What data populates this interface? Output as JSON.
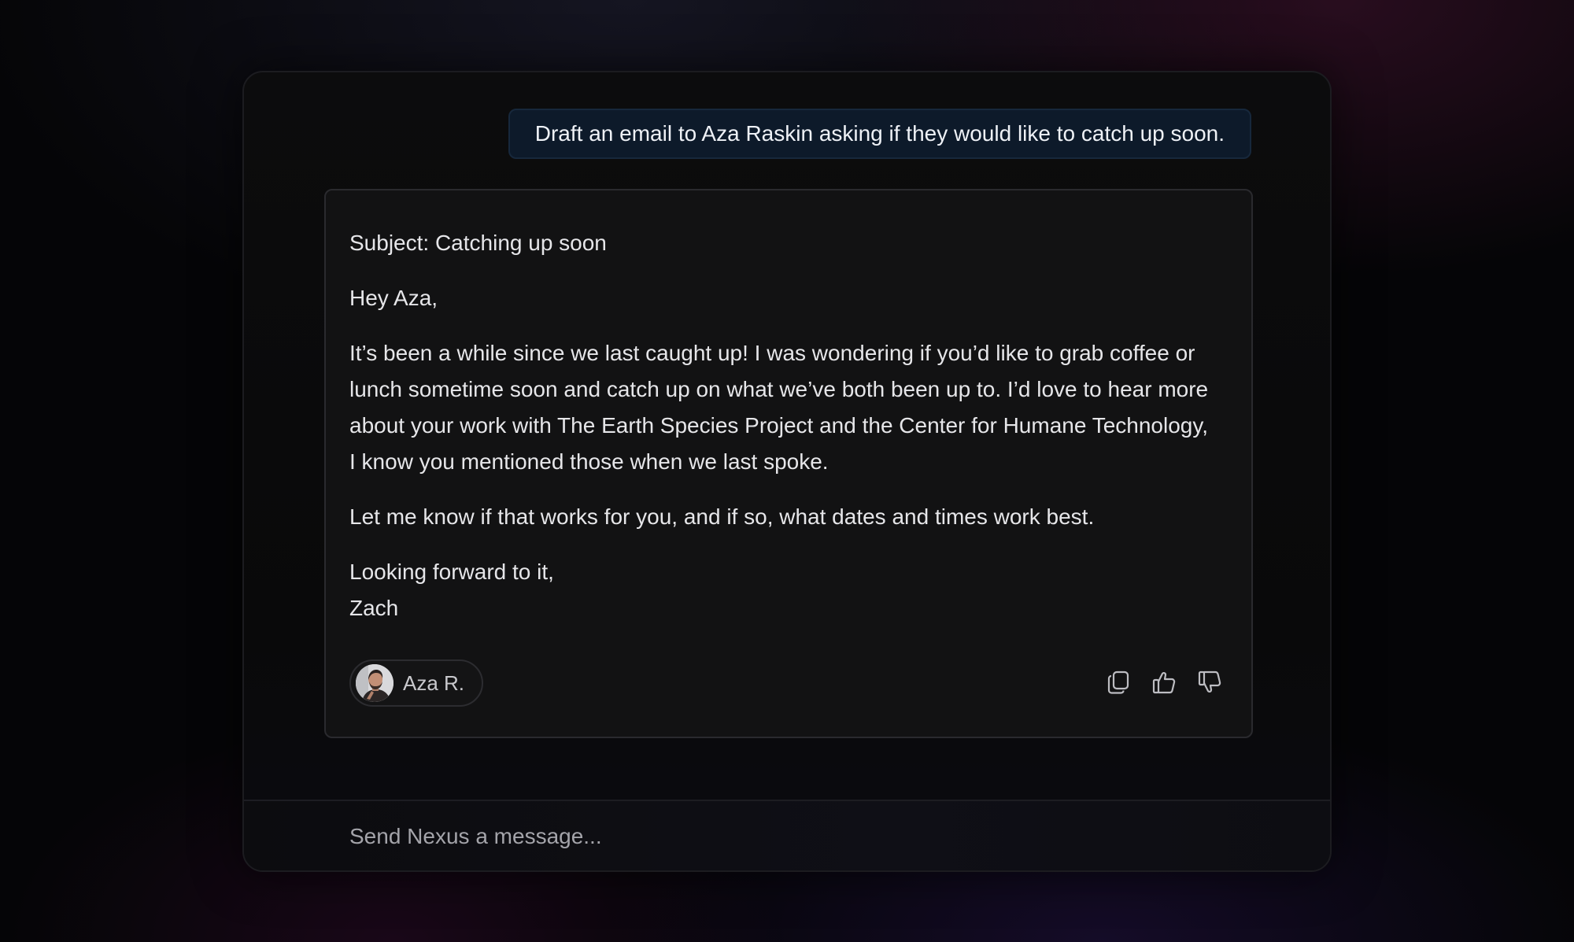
{
  "conversation": {
    "user_message": "Draft an email to Aza Raskin asking if they would like to catch up soon.",
    "reply": {
      "subject": "Subject: Catching up soon",
      "greeting": "Hey Aza,",
      "body_1": "It’s been a while since we last caught up! I was wondering if you’d like to grab coffee or lunch sometime soon and catch up on what we’ve both been up to. I’d love to hear more about your work with The Earth Species Project and the Center for Humane Technology, I know you mentioned those when we last spoke.",
      "body_2": "Let me know if that works for you, and if so, what dates and times work best.",
      "closing": "Looking forward to it,",
      "signature": "Zach"
    },
    "contact_chip": {
      "label": "Aza R.",
      "avatar_icon": "person-avatar"
    },
    "actions": [
      {
        "name": "copy",
        "icon": "copy-icon"
      },
      {
        "name": "thumbs-up",
        "icon": "thumbs-up-icon"
      },
      {
        "name": "thumbs-down",
        "icon": "thumbs-down-icon"
      }
    ]
  },
  "composer": {
    "placeholder": "Send Nexus a message...",
    "value": ""
  },
  "colors": {
    "background": "#050507",
    "window": "#0b0b0c",
    "user_bubble": "#0d1a2a",
    "card": "#121213",
    "text": "#e6e6e9",
    "muted_text": "#a4a4aa"
  }
}
